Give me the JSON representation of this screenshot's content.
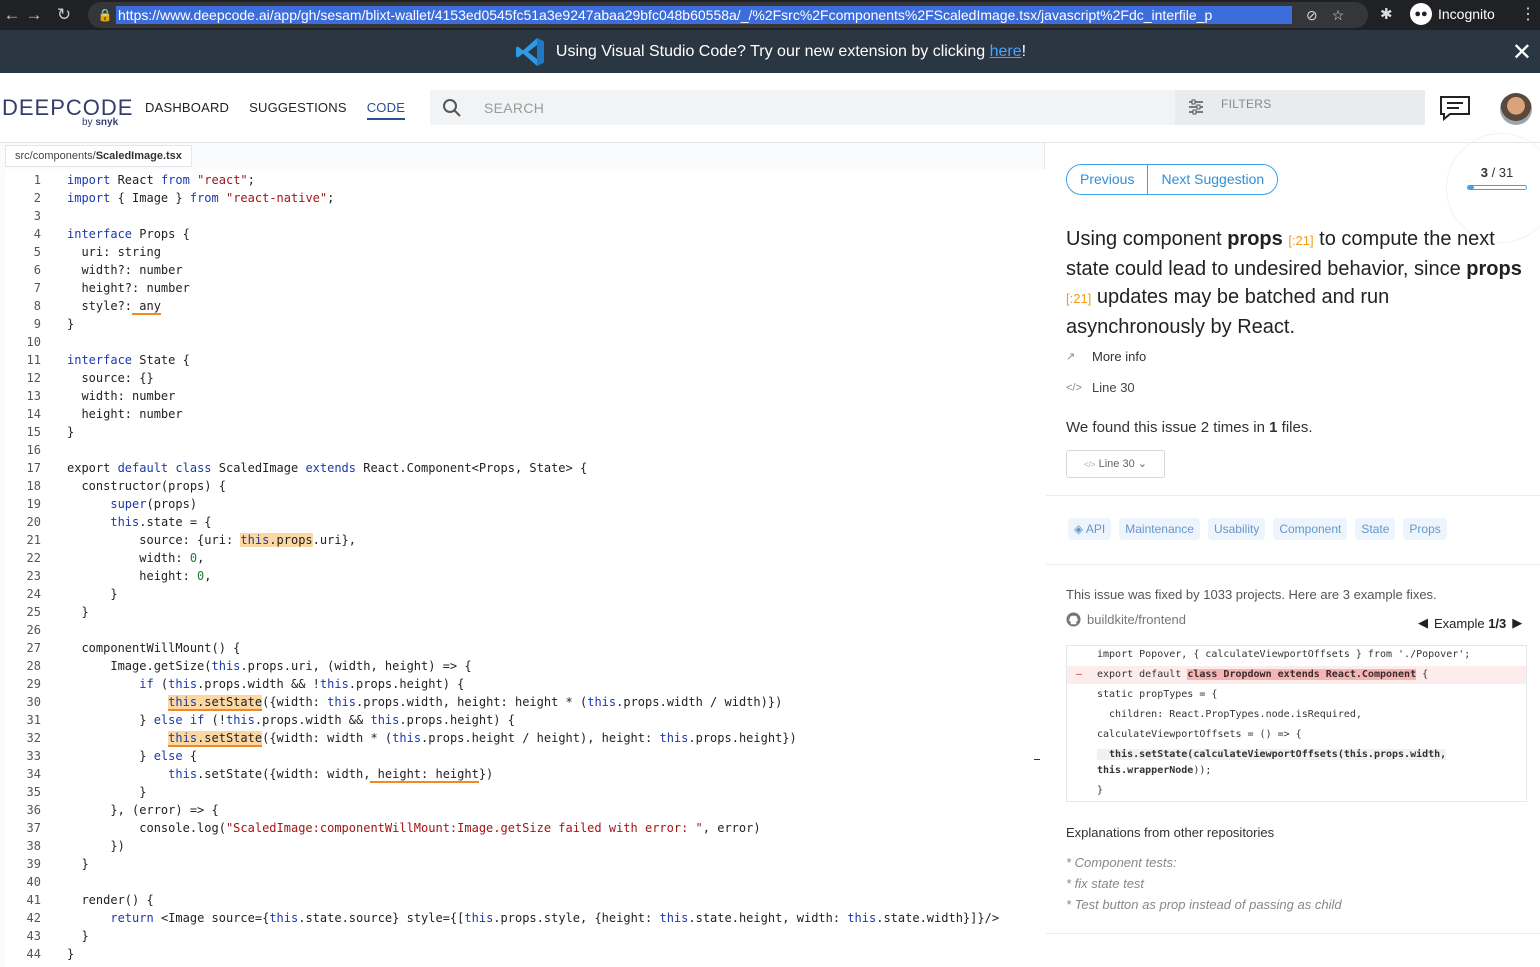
{
  "browser": {
    "url": "https://www.deepcode.ai/app/gh/sesam/blixt-wallet/4153ed0545fc51a3e9247abaa29bfc048b60558a/_/%2Fsrc%2Fcomponents%2FScaledImage.tsx/javascript%2Fdc_interfile_p",
    "profile_label": "Incognito",
    "icons": [
      "back-icon",
      "forward-icon",
      "reload-icon",
      "lock-icon",
      "eye-off-icon",
      "star-icon",
      "puzzle-icon",
      "incognito-icon",
      "menu-icon"
    ]
  },
  "banner": {
    "text_before": "Using Visual Studio Code? Try our new extension by clicking ",
    "link": "here",
    "text_after": "!",
    "colors": {
      "background": "#2a3642",
      "link": "#4aa3ff"
    }
  },
  "header": {
    "logo_text": "DEEPCODE",
    "logo_sub_prefix": "by ",
    "logo_sub_brand": "snyk",
    "nav": [
      "DASHBOARD",
      "SUGGESTIONS",
      "CODE"
    ],
    "active_nav": "CODE",
    "search_placeholder": "SEARCH",
    "filters_label": "FILTERS"
  },
  "file": {
    "path_prefix": "src/components/",
    "name": "ScaledImage.tsx"
  },
  "code_lines": [
    "import React from \"react\";",
    "import { Image } from \"react-native\";",
    "",
    "interface Props {",
    "  uri: string",
    "  width?: number",
    "  height?: number",
    "  style?: any",
    "}",
    "",
    "interface State {",
    "  source: {}",
    "  width: number",
    "  height: number",
    "}",
    "",
    "export default class ScaledImage extends React.Component<Props, State> {",
    "  constructor(props) {",
    "      super(props)",
    "      this.state = {",
    "          source: {uri: this.props.uri},",
    "          width: 0,",
    "          height: 0,",
    "      }",
    "  }",
    "",
    "  componentWillMount() {",
    "      Image.getSize(this.props.uri, (width, height) => {",
    "          if (this.props.width && !this.props.height) {",
    "              this.setState({width: this.props.width, height: height * (this.props.width / width)})",
    "          } else if (!this.props.width && this.props.height) {",
    "              this.setState({width: width * (this.props.height / height), height: this.props.height})",
    "          } else {",
    "              this.setState({width: width, height: height})",
    "          }",
    "      }, (error) => {",
    "          console.log(\"ScaledImage:componentWillMount:Image.getSize failed with error: \", error)",
    "      })",
    "  }",
    "",
    "  render() {",
    "      return <Image source={this.state.source} style={[this.props.style, {height: this.state.height, width: this.state.width}]}/>",
    "  }",
    "}"
  ],
  "suggestion": {
    "prev_label": "Previous",
    "next_label": "Next Suggestion",
    "current": "3",
    "total": "31",
    "progress": 0.097,
    "message_parts": {
      "a": "Using component ",
      "b": "props",
      "c": "[:21]",
      "d": " to compute the next state could lead to undesired behavior, since ",
      "e": "props",
      "f": "[:21]",
      "g": " updates may be batched and run asynchronously by React."
    },
    "more_info": "More info",
    "line_ref": "Line 30",
    "found_prefix": "We found this issue 2 times in ",
    "found_count": "1",
    "found_suffix": " files.",
    "line_select": "Line 30",
    "tags": [
      "API",
      "Maintenance",
      "Usability",
      "Component",
      "State",
      "Props"
    ],
    "fix_intro": "This issue was fixed by 1033 projects. Here are 3 example fixes.",
    "repo": "buildkite/frontend",
    "example_prefix": "Example ",
    "example_current": "1/3",
    "diff": {
      "l1": "import Popover, { calculateViewportOffsets } from './Popover';",
      "l2_pre": "export default ",
      "l2_strike": "class Dropdown extends React.Component",
      "l2_post": " {",
      "l3": "static propTypes = {",
      "l4": "  children: React.PropTypes.node.isRequired,",
      "l5": "calculateViewportOffsets = () => {",
      "l6": "  this.setState(calculateViewportOffsets(this.props.width,",
      "l7a": "this.wrapperNode",
      "l7b": "));",
      "l8": "}"
    },
    "explanations_title": "Explanations from other repositories",
    "explanations": [
      "* Component tests:",
      "* fix state test",
      "* Test button as prop instead of passing as child"
    ],
    "colors": {
      "accent": "#3fa1e8",
      "ref": "#f39c12",
      "tag_bg": "#eef4fb",
      "tag_text": "#6497cf",
      "highlight": "#fbd7a4"
    }
  }
}
